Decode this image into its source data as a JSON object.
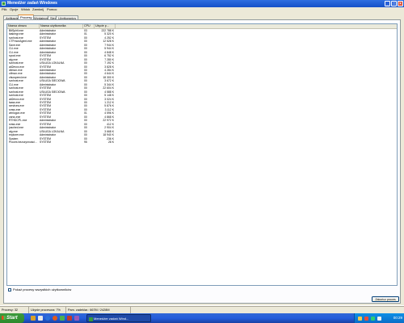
{
  "window": {
    "title": "Menedżer zadań Windows",
    "controls": {
      "minimize": "_",
      "maximize": "□",
      "close": "×"
    }
  },
  "menu": [
    "Plik",
    "Opcje",
    "Widok",
    "Zamknij",
    "Pomoc"
  ],
  "tabs": [
    "Aplikacje",
    "Procesy",
    "Wydajność",
    "Sieć",
    "Użytkownicy"
  ],
  "active_tab": "Procesy",
  "process_table": {
    "columns": [
      "Nazwa obrazu",
      "Nazwa użytkownika",
      "CPU",
      "Użycie p..."
    ],
    "rows": [
      [
        "BitSpirit.exe",
        "Administrator",
        "03",
        "222 788 K"
      ],
      [
        "taskmgr.exe",
        "Administrator",
        "01",
        "5 320 K"
      ],
      [
        "svchost.exe",
        "SYSTEM",
        "00",
        "4 252 K"
      ],
      [
        "CTFmonAgent.exe",
        "Administrator",
        "00",
        "12 528 K"
      ],
      [
        "Save.exe",
        "Administrator",
        "00",
        "7 944 K"
      ],
      [
        "CLI.exe",
        "Administrator",
        "00",
        "5 944 K"
      ],
      [
        "CLI.exe",
        "Administrator",
        "00",
        "4 848 K"
      ],
      [
        "spool.exe",
        "SYSTEM",
        "00",
        "6 752 K"
      ],
      [
        "alg.exe",
        "SYSTEM",
        "00",
        "7 280 K"
      ],
      [
        "svchost.exe",
        "USŁUGA LOKALNA",
        "00",
        "7 192 K"
      ],
      [
        "ati2evxx.exe",
        "SYSTEM",
        "00",
        "3 828 K"
      ],
      [
        "ditmon.exe",
        "Administrator",
        "00",
        "4 284 K"
      ],
      [
        "ctfmon.exe",
        "Administrator",
        "00",
        "4 644 K"
      ],
      [
        "cfsospeed.exe",
        "Administrator",
        "00",
        "18 300 K"
      ],
      [
        "svchost.exe",
        "USŁUGA SIECIOWA",
        "00",
        "3 672 K"
      ],
      [
        "CLI.exe",
        "Administrator",
        "00",
        "5 344 K"
      ],
      [
        "svchost.exe",
        "SYSTEM",
        "00",
        "22 604 K"
      ],
      [
        "svchost.exe",
        "USŁUGA SIECIOWA",
        "00",
        "4 588 K"
      ],
      [
        "svchost.exe",
        "SYSTEM",
        "00",
        "5 148 K"
      ],
      [
        "ati2evxx.exe",
        "SYSTEM",
        "00",
        "3 024 K"
      ],
      [
        "lsass.exe",
        "SYSTEM",
        "00",
        "1 212 K"
      ],
      [
        "services.exe",
        "SYSTEM",
        "00",
        "5 876 K"
      ],
      [
        "smss.exe",
        "SYSTEM",
        "00",
        "3 112 K"
      ],
      [
        "winlogon.exe",
        "SYSTEM",
        "01",
        "4 596 K"
      ],
      [
        "csrss.exe",
        "SYSTEM",
        "00",
        "4 868 K"
      ],
      [
        "RTHDCPL.exe",
        "Administrator",
        "00",
        "22 972 K"
      ],
      [
        "smss.exe",
        "SYSTEM",
        "00",
        "412 K"
      ],
      [
        "jusched.exe",
        "Administrator",
        "00",
        "2 904 K"
      ],
      [
        "alg.exe",
        "USŁUGA LOKALNA",
        "00",
        "3 668 K"
      ],
      [
        "explorer.exe",
        "Administrator",
        "00",
        "18 940 K"
      ],
      [
        "System",
        "SYSTEM",
        "00",
        "236 K"
      ],
      [
        "Proces bezczynności...",
        "SYSTEM",
        "95",
        "28 K"
      ]
    ]
  },
  "show_all_users_label": "Pokaż procesy wszystkich użytkowników",
  "end_process_label": "Zakończ proces",
  "statusbar": {
    "processes": "Procesy: 32",
    "cpu_usage": "Użycie procesora: 7%",
    "commit": "Pam. zadeklar.: 667M / 2428M"
  },
  "taskbar": {
    "start_label": "Start",
    "window_button": "Menedżer zadań Wind...",
    "clock": "00:29"
  },
  "colors": {
    "title_blue": "#1550c8",
    "start_green": "#3c9b3c",
    "dialog_gray": "#ece9d8"
  }
}
